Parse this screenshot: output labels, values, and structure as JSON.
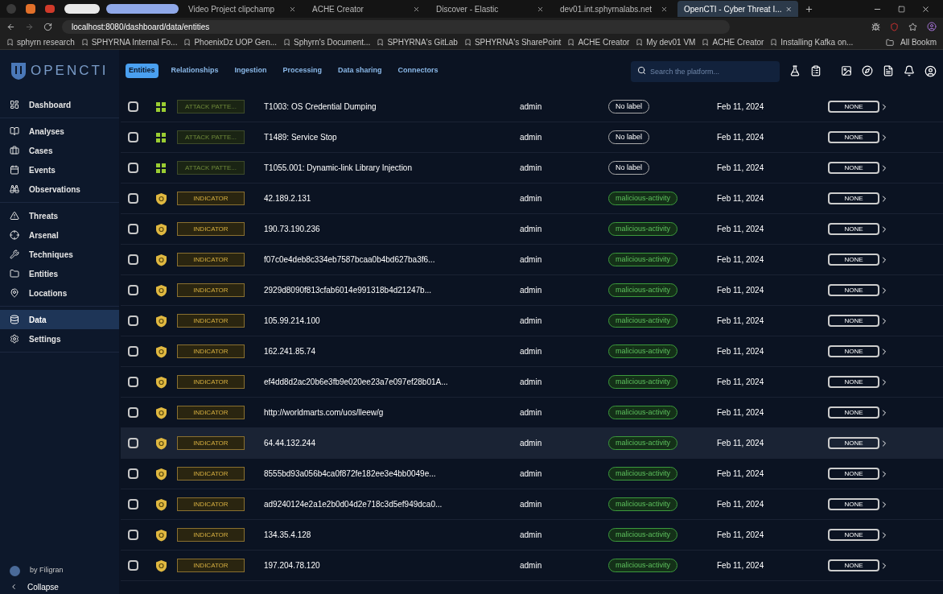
{
  "browser": {
    "tabs": [
      {
        "label": "Video Project clipchamp",
        "selected": false
      },
      {
        "label": "ACHE Creator",
        "selected": false
      },
      {
        "label": "Discover - Elastic",
        "selected": false
      },
      {
        "label": "dev01.int.sphyrnalabs.net",
        "selected": false
      },
      {
        "label": "OpenCTI - Cyber Threat I...",
        "selected": true
      }
    ],
    "address": "localhost:8080/dashboard/data/entities",
    "bookmarks": [
      "sphyrn research",
      "SPHYRNA Internal Fo...",
      "PhoenixDz UOP Gen...",
      "Sphyrn's Document...",
      "SPHYRNA's GitLab",
      "SPHYRNA's SharePoint",
      "ACHE Creator",
      "My dev01 VM",
      "ACHE Creator",
      "Installing Kafka on..."
    ],
    "all_bookmarks": "All Bookm"
  },
  "app": {
    "logo": "OPENCTI",
    "nav_tabs": [
      {
        "label": "Entities",
        "selected": true
      },
      {
        "label": "Relationships",
        "selected": false
      },
      {
        "label": "Ingestion",
        "selected": false
      },
      {
        "label": "Processing",
        "selected": false
      },
      {
        "label": "Data sharing",
        "selected": false
      },
      {
        "label": "Connectors",
        "selected": false
      }
    ],
    "search": {
      "placeholder": "Search the platform..."
    },
    "sidebar": {
      "groups": [
        [
          {
            "label": "Dashboard",
            "selected": false
          }
        ],
        [
          {
            "label": "Analyses",
            "selected": false
          },
          {
            "label": "Cases",
            "selected": false
          },
          {
            "label": "Events",
            "selected": false
          },
          {
            "label": "Observations",
            "selected": false
          }
        ],
        [
          {
            "label": "Threats",
            "selected": false
          },
          {
            "label": "Arsenal",
            "selected": false
          },
          {
            "label": "Techniques",
            "selected": false
          },
          {
            "label": "Entities",
            "selected": false
          },
          {
            "label": "Locations",
            "selected": false
          }
        ],
        [
          {
            "label": "Data",
            "selected": true
          },
          {
            "label": "Settings",
            "selected": false
          }
        ]
      ],
      "footer": "by Filigran",
      "collapse": "Collapse"
    },
    "rows": [
      {
        "kind": "attack-pattern",
        "type": "ATTACK PATTE...",
        "name": "T1003: OS Credential Dumping",
        "creator": "admin",
        "label": "No label",
        "date": "Feb 11, 2024",
        "marking": "NONE",
        "checked": false,
        "highlighted": false
      },
      {
        "kind": "attack-pattern",
        "type": "ATTACK PATTE...",
        "name": "T1489: Service Stop",
        "creator": "admin",
        "label": "No label",
        "date": "Feb 11, 2024",
        "marking": "NONE",
        "checked": false,
        "highlighted": false
      },
      {
        "kind": "attack-pattern",
        "type": "ATTACK PATTE...",
        "name": "T1055.001: Dynamic-link Library Injection",
        "creator": "admin",
        "label": "No label",
        "date": "Feb 11, 2024",
        "marking": "NONE",
        "checked": false,
        "highlighted": false
      },
      {
        "kind": "indicator",
        "type": "INDICATOR",
        "name": "42.189.2.131",
        "creator": "admin",
        "label": "malicious-activity",
        "date": "Feb 11, 2024",
        "marking": "NONE",
        "checked": false,
        "highlighted": false
      },
      {
        "kind": "indicator",
        "type": "INDICATOR",
        "name": "190.73.190.236",
        "creator": "admin",
        "label": "malicious-activity",
        "date": "Feb 11, 2024",
        "marking": "NONE",
        "checked": false,
        "highlighted": false
      },
      {
        "kind": "indicator",
        "type": "INDICATOR",
        "name": "f07c0e4deb8c334eb7587bcaa0b4bd627ba3f6...",
        "creator": "admin",
        "label": "malicious-activity",
        "date": "Feb 11, 2024",
        "marking": "NONE",
        "checked": false,
        "highlighted": false
      },
      {
        "kind": "indicator",
        "type": "INDICATOR",
        "name": "2929d8090f813cfab6014e991318b4d21247b...",
        "creator": "admin",
        "label": "malicious-activity",
        "date": "Feb 11, 2024",
        "marking": "NONE",
        "checked": false,
        "highlighted": false
      },
      {
        "kind": "indicator",
        "type": "INDICATOR",
        "name": "105.99.214.100",
        "creator": "admin",
        "label": "malicious-activity",
        "date": "Feb 11, 2024",
        "marking": "NONE",
        "checked": false,
        "highlighted": false
      },
      {
        "kind": "indicator",
        "type": "INDICATOR",
        "name": "162.241.85.74",
        "creator": "admin",
        "label": "malicious-activity",
        "date": "Feb 11, 2024",
        "marking": "NONE",
        "checked": false,
        "highlighted": false
      },
      {
        "kind": "indicator",
        "type": "INDICATOR",
        "name": "ef4dd8d2ac20b6e3fb9e020ee23a7e097ef28b01A...",
        "creator": "admin",
        "label": "malicious-activity",
        "date": "Feb 11, 2024",
        "marking": "NONE",
        "checked": false,
        "highlighted": false
      },
      {
        "kind": "indicator",
        "type": "INDICATOR",
        "name": "http://worldmarts.com/uos/lleew/g",
        "creator": "admin",
        "label": "malicious-activity",
        "date": "Feb 11, 2024",
        "marking": "NONE",
        "checked": false,
        "highlighted": false
      },
      {
        "kind": "indicator",
        "type": "INDICATOR",
        "name": "64.44.132.244",
        "creator": "admin",
        "label": "malicious-activity",
        "date": "Feb 11, 2024",
        "marking": "NONE",
        "checked": false,
        "highlighted": true
      },
      {
        "kind": "indicator",
        "type": "INDICATOR",
        "name": "8555bd93a056b4ca0f872fe182ee3e4bb0049e...",
        "creator": "admin",
        "label": "malicious-activity",
        "date": "Feb 11, 2024",
        "marking": "NONE",
        "checked": false,
        "highlighted": false
      },
      {
        "kind": "indicator",
        "type": "INDICATOR",
        "name": "ad9240124e2a1e2b0d04d2e718c3d5ef949dca0...",
        "creator": "admin",
        "label": "malicious-activity",
        "date": "Feb 11, 2024",
        "marking": "NONE",
        "checked": false,
        "highlighted": false
      },
      {
        "kind": "indicator",
        "type": "INDICATOR",
        "name": "134.35.4.128",
        "creator": "admin",
        "label": "malicious-activity",
        "date": "Feb 11, 2024",
        "marking": "NONE",
        "checked": false,
        "highlighted": false
      },
      {
        "kind": "indicator",
        "type": "INDICATOR",
        "name": "197.204.78.120",
        "creator": "admin",
        "label": "malicious-activity",
        "date": "Feb 11, 2024",
        "marking": "NONE",
        "checked": false,
        "highlighted": false
      }
    ]
  }
}
